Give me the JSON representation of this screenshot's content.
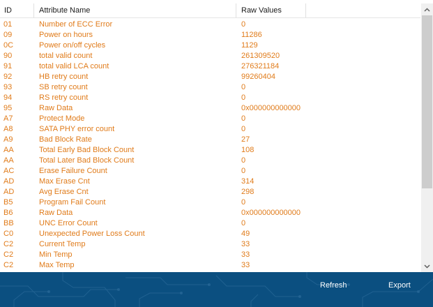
{
  "table": {
    "columns": {
      "id": "ID",
      "name": "Attribute Name",
      "raw": "Raw Values"
    },
    "rows": [
      {
        "id": "01",
        "name": "Number of ECC Error",
        "raw": "0"
      },
      {
        "id": "09",
        "name": "Power on hours",
        "raw": "11286"
      },
      {
        "id": "0C",
        "name": "Power on/off cycles",
        "raw": "1129"
      },
      {
        "id": "90",
        "name": "total valid count",
        "raw": "261309520"
      },
      {
        "id": "91",
        "name": "total valid LCA count",
        "raw": "276321184"
      },
      {
        "id": "92",
        "name": "HB retry count",
        "raw": "99260404"
      },
      {
        "id": "93",
        "name": "SB retry count",
        "raw": "0"
      },
      {
        "id": "94",
        "name": "RS retry count",
        "raw": "0"
      },
      {
        "id": "95",
        "name": "Raw Data",
        "raw": "0x000000000000"
      },
      {
        "id": "A7",
        "name": "Protect Mode",
        "raw": "0"
      },
      {
        "id": "A8",
        "name": "SATA PHY error count",
        "raw": "0"
      },
      {
        "id": "A9",
        "name": "Bad Block Rate",
        "raw": "27"
      },
      {
        "id": "AA",
        "name": "Total Early Bad Block Count",
        "raw": "108"
      },
      {
        "id": "AA",
        "name": "Total Later Bad Block Count",
        "raw": "0"
      },
      {
        "id": "AC",
        "name": "Erase Failure Count",
        "raw": "0"
      },
      {
        "id": "AD",
        "name": "Max Erase Cnt",
        "raw": "314"
      },
      {
        "id": "AD",
        "name": "Avg Erase Cnt",
        "raw": "298"
      },
      {
        "id": "B5",
        "name": "Program Fail Count",
        "raw": "0"
      },
      {
        "id": "B6",
        "name": "Raw Data",
        "raw": "0x000000000000"
      },
      {
        "id": "BB",
        "name": "UNC Error Count",
        "raw": "0"
      },
      {
        "id": "C0",
        "name": "Unexpected Power Loss Count",
        "raw": "49"
      },
      {
        "id": "C2",
        "name": "Current Temp",
        "raw": "33"
      },
      {
        "id": "C2",
        "name": "Min Temp",
        "raw": "33"
      },
      {
        "id": "C2",
        "name": "Max Temp",
        "raw": "33"
      }
    ]
  },
  "footer": {
    "refresh_label": "Refresh",
    "export_label": "Export"
  },
  "colors": {
    "row_text": "#e07b1a",
    "footer_bg": "#0b4f80",
    "scrollbar_track": "#f0f0f0",
    "scrollbar_thumb": "#cdcdcd"
  },
  "icons": {
    "scroll_up": "chevron-up-icon",
    "scroll_down": "chevron-down-icon"
  }
}
